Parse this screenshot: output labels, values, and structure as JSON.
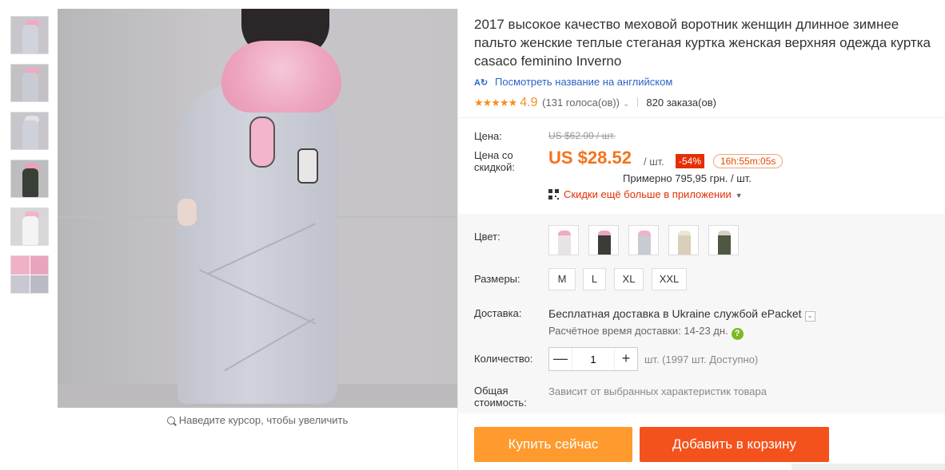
{
  "gallery": {
    "thumbnails": [
      "thumb-1",
      "thumb-2",
      "thumb-3",
      "thumb-4",
      "thumb-5",
      "thumb-6"
    ],
    "zoom_hint": "Наведите курсор, чтобы увеличить"
  },
  "product": {
    "title": "2017 высокое качество меховой воротник женщин длинное зимнее пальто женские теплые стеганая куртка женская верхняя одежда куртка casaco feminino Inverno",
    "translate_icon": "А",
    "translate_link": "Посмотреть название на английском",
    "stars": "★★★★★",
    "rating": "4.9",
    "votes": "(131 голоса(ов))",
    "orders": "820 заказа(ов)"
  },
  "pricing": {
    "price_label": "Цена:",
    "old_price": "US $62.00 / шт.",
    "discount_price_label": "Цена со скидкой:",
    "new_price": "US $28.52",
    "unit": "/ шт.",
    "discount_badge": "-54%",
    "timer": "16h:55m:05s",
    "approx": "Примерно 795,95 грн. / шт.",
    "app_promo": "Скидки ещё больше в приложении"
  },
  "properties": {
    "color_label": "Цвет:",
    "sizes_label": "Размеры:",
    "sizes": [
      "M",
      "L",
      "XL",
      "XXL"
    ],
    "shipping_label": "Доставка:",
    "shipping_main": "Бесплатная доставка в Ukraine службой ePacket",
    "shipping_time": "Расчётное время доставки: 14-23 дн.",
    "quantity_label": "Количество:",
    "quantity_value": "1",
    "minus": "—",
    "plus": "+",
    "availability": "шт. (1997 шт. Доступно)",
    "total_label": "Общая стоимость:",
    "total_note": "Зависит от выбранных характеристик товара"
  },
  "actions": {
    "buy_now": "Купить сейчас",
    "add_to_cart": "Добавить в корзину"
  },
  "colors": {
    "price_orange": "#f5721a",
    "discount_red": "#e62e04",
    "buy_button": "#ff9a2e",
    "cart_button": "#f4521d",
    "link_blue": "#2d63c8",
    "star_orange": "#f5901e",
    "help_green": "#7bb929"
  }
}
